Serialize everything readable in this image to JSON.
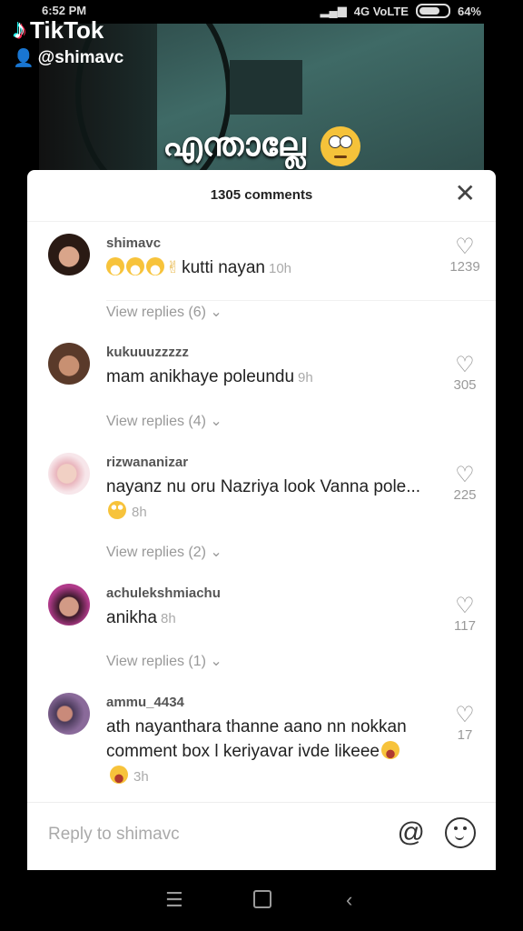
{
  "status_bar": {
    "time": "6:52 PM",
    "network": "4G VoLTE",
    "battery": "64%",
    "battery_level": 0.64
  },
  "app": {
    "name": "TikTok",
    "handle": "@shimavc"
  },
  "video": {
    "caption": "എന്താല്ലേ"
  },
  "comments_panel": {
    "count_label": "1305 comments",
    "comments": [
      {
        "username": "shimavc",
        "text": "kutti nayan",
        "time": "10h",
        "likes": "1239",
        "replies": "View replies (6)"
      },
      {
        "username": "kukuuuzzzzz",
        "text": "mam anikhaye poleundu",
        "time": "9h",
        "likes": "305",
        "replies": "View replies (4)"
      },
      {
        "username": "rizwananizar",
        "text": "nayanz nu oru Nazriya look Vanna pole...",
        "time": "8h",
        "likes": "225",
        "replies": "View replies (2)"
      },
      {
        "username": "achulekshmiachu",
        "text": "anikha",
        "time": "8h",
        "likes": "117",
        "replies": "View replies (1)"
      },
      {
        "username": "ammu_4434",
        "text": "ath nayanthara thanne aano nn nokkan comment box l keriyavar ivde likeee",
        "time": "3h",
        "likes": "17"
      }
    ],
    "reply_placeholder": "Reply to shimavc"
  },
  "icons": {
    "close": "close-icon",
    "heart": "heart-icon",
    "mention": "at-icon",
    "emoji": "emoji-icon",
    "chevron": "chevron-down-icon"
  }
}
